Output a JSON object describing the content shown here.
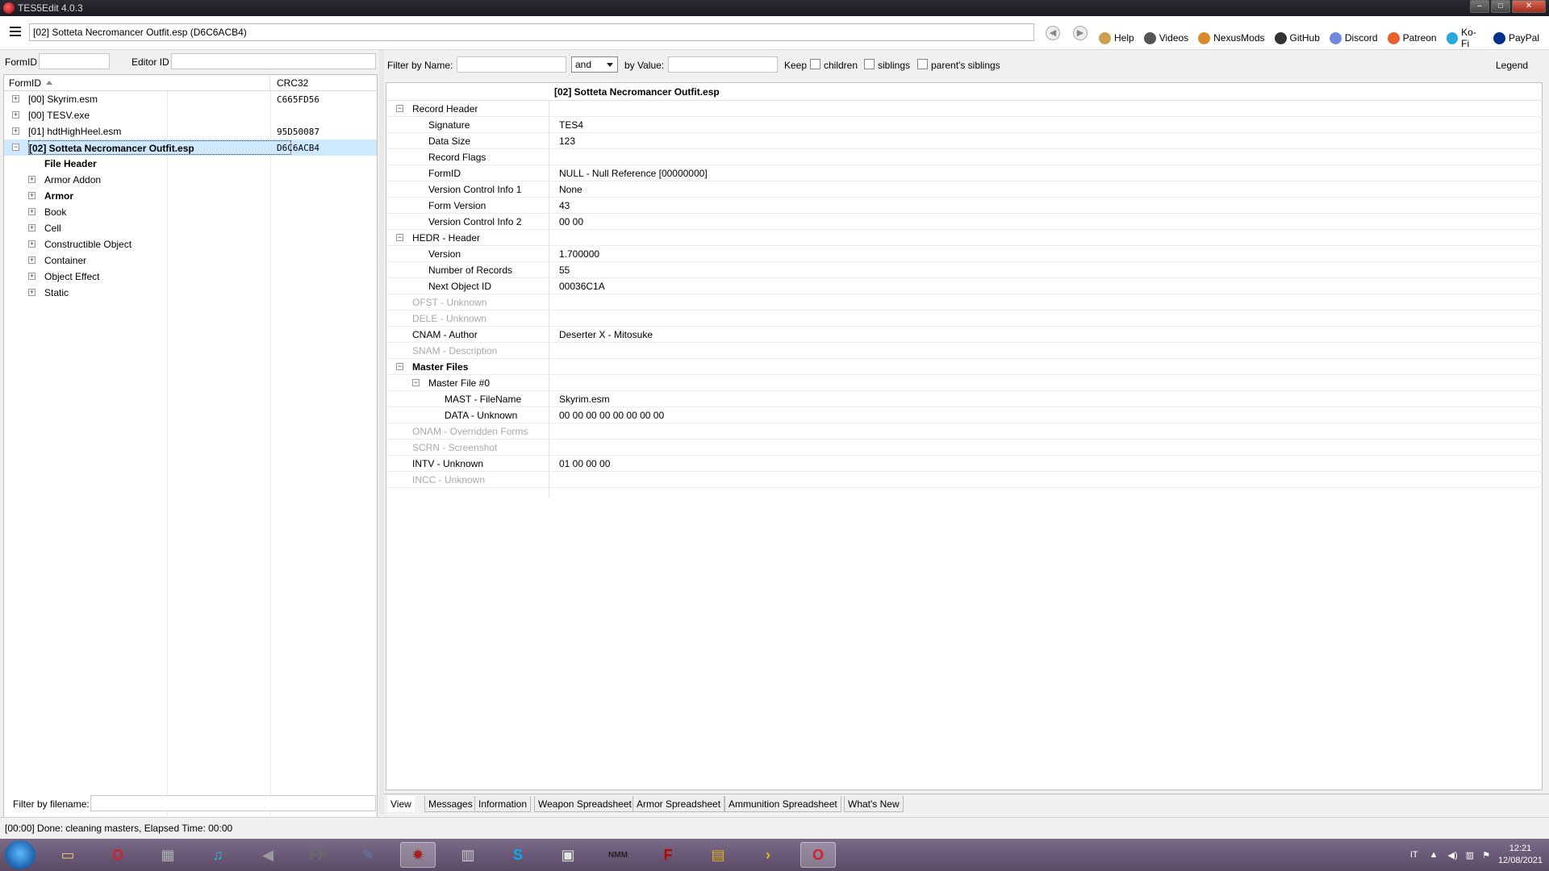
{
  "window": {
    "title": "TES5Edit 4.0.3"
  },
  "toolbar": {
    "path": "[02] Sotteta Necromancer Outfit.esp (D6C6ACB4)",
    "links": [
      {
        "label": "Help",
        "icon": "book-icon",
        "color": "#c8a050"
      },
      {
        "label": "Videos",
        "icon": "video-icon",
        "color": "#555555"
      },
      {
        "label": "NexusMods",
        "icon": "nexus-icon",
        "color": "#d98b2b"
      },
      {
        "label": "GitHub",
        "icon": "github-icon",
        "color": "#333333"
      },
      {
        "label": "Discord",
        "icon": "discord-icon",
        "color": "#7289da"
      },
      {
        "label": "Patreon",
        "icon": "patreon-icon",
        "color": "#e8602c"
      },
      {
        "label": "Ko-Fi",
        "icon": "kofi-icon",
        "color": "#29abe0"
      },
      {
        "label": "PayPal",
        "icon": "paypal-icon",
        "color": "#003087"
      }
    ]
  },
  "left": {
    "formid_label": "FormID",
    "editorid_label": "Editor ID",
    "columns": [
      "FormID",
      "CRC32"
    ],
    "tree": [
      {
        "label": "[00] Skyrim.esm",
        "crc": "C665FD56",
        "level": 0,
        "expander": "+"
      },
      {
        "label": "[00] TESV.exe",
        "crc": "",
        "level": 0,
        "expander": "+"
      },
      {
        "label": "[01] hdtHighHeel.esm",
        "crc": "95D50087",
        "level": 0,
        "expander": "+"
      },
      {
        "label": "[02] Sotteta Necromancer Outfit.esp",
        "crc": "D6C6ACB4",
        "level": 0,
        "expander": "-",
        "selected": true,
        "bold": true
      },
      {
        "label": "File Header",
        "crc": "",
        "level": 1,
        "expander": "",
        "bold": true
      },
      {
        "label": "Armor Addon",
        "crc": "",
        "level": 1,
        "expander": "+"
      },
      {
        "label": "Armor",
        "crc": "",
        "level": 1,
        "expander": "+",
        "bold": true
      },
      {
        "label": "Book",
        "crc": "",
        "level": 1,
        "expander": "+"
      },
      {
        "label": "Cell",
        "crc": "",
        "level": 1,
        "expander": "+"
      },
      {
        "label": "Constructible Object",
        "crc": "",
        "level": 1,
        "expander": "+"
      },
      {
        "label": "Container",
        "crc": "",
        "level": 1,
        "expander": "+"
      },
      {
        "label": "Object Effect",
        "crc": "",
        "level": 1,
        "expander": "+"
      },
      {
        "label": "Static",
        "crc": "",
        "level": 1,
        "expander": "+"
      }
    ],
    "filter_filename_label": "Filter by filename:"
  },
  "right": {
    "filter_name_label": "Filter by Name:",
    "operator": "and",
    "by_value_label": "by Value:",
    "keep_label": "Keep",
    "children_label": "children",
    "siblings_label": "siblings",
    "parents_siblings_label": "parent's siblings",
    "legend_label": "Legend",
    "record_title": "[02] Sotteta Necromancer Outfit.esp",
    "rows": [
      {
        "name": "Record Header",
        "value": "",
        "level": 0,
        "expander": "-",
        "dim": false,
        "bold": false
      },
      {
        "name": "Signature",
        "value": "TES4",
        "level": 1,
        "expander": "",
        "dim": false
      },
      {
        "name": "Data Size",
        "value": "123",
        "level": 1,
        "expander": "",
        "dim": false
      },
      {
        "name": "Record Flags",
        "value": "",
        "level": 1,
        "expander": "",
        "dim": false
      },
      {
        "name": "FormID",
        "value": "NULL - Null Reference [00000000]",
        "level": 1,
        "expander": "",
        "dim": false
      },
      {
        "name": "Version Control Info 1",
        "value": "None",
        "level": 1,
        "expander": "",
        "dim": false
      },
      {
        "name": "Form Version",
        "value": "43",
        "level": 1,
        "expander": "",
        "dim": false
      },
      {
        "name": "Version Control Info 2",
        "value": "00 00",
        "level": 1,
        "expander": "",
        "dim": false
      },
      {
        "name": "HEDR - Header",
        "value": "",
        "level": 0,
        "expander": "-",
        "dim": false
      },
      {
        "name": "Version",
        "value": "1.700000",
        "level": 1,
        "expander": "",
        "dim": false
      },
      {
        "name": "Number of Records",
        "value": "55",
        "level": 1,
        "expander": "",
        "dim": false
      },
      {
        "name": "Next Object ID",
        "value": "00036C1A",
        "level": 1,
        "expander": "",
        "dim": false
      },
      {
        "name": "OFST - Unknown",
        "value": "",
        "level": 0,
        "expander": "",
        "dim": true
      },
      {
        "name": "DELE - Unknown",
        "value": "",
        "level": 0,
        "expander": "",
        "dim": true
      },
      {
        "name": "CNAM - Author",
        "value": "Deserter X - Mitosuke",
        "level": 0,
        "expander": "",
        "dim": false
      },
      {
        "name": "SNAM - Description",
        "value": "",
        "level": 0,
        "expander": "",
        "dim": true
      },
      {
        "name": "Master Files",
        "value": "",
        "level": 0,
        "expander": "-",
        "dim": false,
        "bold": true
      },
      {
        "name": "Master File #0",
        "value": "",
        "level": 1,
        "expander": "-",
        "dim": false
      },
      {
        "name": "MAST - FileName",
        "value": "Skyrim.esm",
        "level": 2,
        "expander": "",
        "dim": false
      },
      {
        "name": "DATA - Unknown",
        "value": "00 00 00 00 00 00 00 00",
        "level": 2,
        "expander": "",
        "dim": false
      },
      {
        "name": "ONAM - Overridden Forms",
        "value": "",
        "level": 0,
        "expander": "",
        "dim": true
      },
      {
        "name": "SCRN - Screenshot",
        "value": "",
        "level": 0,
        "expander": "",
        "dim": true
      },
      {
        "name": "INTV - Unknown",
        "value": "01 00 00 00",
        "level": 0,
        "expander": "",
        "dim": false
      },
      {
        "name": "INCC - Unknown",
        "value": "",
        "level": 0,
        "expander": "",
        "dim": true
      }
    ],
    "tabs": [
      "View",
      "Messages",
      "Information",
      "Weapon Spreadsheet",
      "Armor Spreadsheet",
      "Ammunition Spreadsheet",
      "What's New"
    ]
  },
  "status": {
    "text": "[00:00] Done: cleaning masters, Elapsed Time: 00:00"
  },
  "taskbar": {
    "items": [
      {
        "icon": "explorer-icon",
        "glyph": "▭",
        "color": "#e8c86a"
      },
      {
        "icon": "opera-icon",
        "glyph": "O",
        "color": "#d41f2c"
      },
      {
        "icon": "film-icon",
        "glyph": "▦",
        "color": "#b0b0b0"
      },
      {
        "icon": "music-icon",
        "glyph": "♫",
        "color": "#27b3d6"
      },
      {
        "icon": "speaker-icon",
        "glyph": "◀",
        "color": "#9a9a9a"
      },
      {
        "icon": "ffdec-icon",
        "glyph": "FF",
        "color": "#6a6a6a"
      },
      {
        "icon": "feather-icon",
        "glyph": "✎",
        "color": "#5a7ab0"
      },
      {
        "icon": "tes5edit-icon",
        "glyph": "✹",
        "color": "#a82020",
        "active": true
      },
      {
        "icon": "figures-icon",
        "glyph": "▥",
        "color": "#cfcfcf"
      },
      {
        "icon": "skype-icon",
        "glyph": "S",
        "color": "#00aff0"
      },
      {
        "icon": "window-icon",
        "glyph": "▣",
        "color": "#dfe8dc"
      },
      {
        "icon": "nmm-icon",
        "glyph": "NMM",
        "color": "#222222"
      },
      {
        "icon": "filezilla-icon",
        "glyph": "F",
        "color": "#bf0000"
      },
      {
        "icon": "archive-icon",
        "glyph": "▤",
        "color": "#e0b020"
      },
      {
        "icon": "arrow-icon",
        "glyph": "›",
        "color": "#d6c020"
      },
      {
        "icon": "opera-gx-icon",
        "glyph": "O",
        "color": "#d41f2c",
        "active": true
      }
    ],
    "lang": "IT",
    "time": "12:21",
    "date": "12/08/2021"
  }
}
